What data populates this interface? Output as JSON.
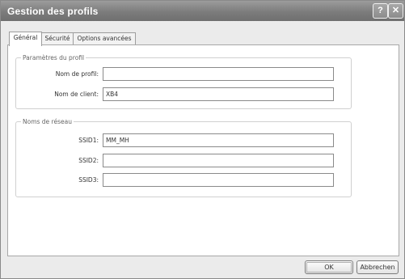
{
  "window": {
    "title": "Gestion des profils",
    "help_glyph": "?",
    "close_glyph": "✕"
  },
  "tabs": [
    {
      "label": "Général",
      "active": true
    },
    {
      "label": "Sécurité",
      "active": false
    },
    {
      "label": "Options avancées",
      "active": false
    }
  ],
  "profile_params": {
    "legend": "Paramètres du profil",
    "profile_name": {
      "label": "Nom de profil:",
      "value": ""
    },
    "client_name": {
      "label": "Nom de client:",
      "value": "XB4"
    }
  },
  "network_names": {
    "legend": "Noms de réseau",
    "ssid1": {
      "label": "SSID1:",
      "value": "MM_MH"
    },
    "ssid2": {
      "label": "SSID2:",
      "value": ""
    },
    "ssid3": {
      "label": "SSID3:",
      "value": ""
    }
  },
  "buttons": {
    "ok": "OK",
    "cancel": "Abbrechen"
  }
}
